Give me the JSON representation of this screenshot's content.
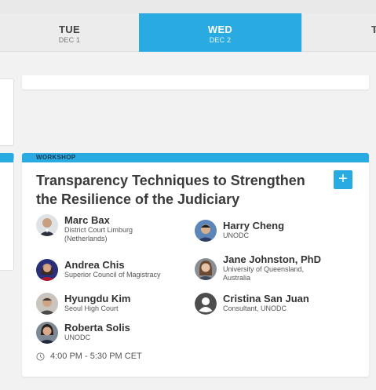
{
  "days": [
    {
      "name": "TUE",
      "date": "DEC 1"
    },
    {
      "name": "WED",
      "date": "DEC 2"
    },
    {
      "name": "T",
      "date": "D"
    }
  ],
  "session": {
    "type": "WORKSHOP",
    "title": "Transparency Techniques to Strengthen the Resilience of the Judiciary",
    "add_label": "+",
    "time": "4:00 PM - 5:30 PM CET",
    "speakers": [
      {
        "name": "Marc Bax",
        "affiliation": "District Court Limburg (Netherlands)",
        "avatar": "photo"
      },
      {
        "name": "Harry Cheng",
        "affiliation": "UNODC",
        "avatar": "photo"
      },
      {
        "name": "Andrea Chis",
        "affiliation": "Superior Council of Magistracy",
        "avatar": "photo"
      },
      {
        "name": "Jane Johnston, PhD",
        "affiliation": "University of Queensland, Australia",
        "avatar": "photo"
      },
      {
        "name": "Hyungdu Kim",
        "affiliation": "Seoul High Court",
        "avatar": "photo"
      },
      {
        "name": "Cristina San Juan",
        "affiliation": "Consultant, UNODC",
        "avatar": "placeholder-user-icon"
      },
      {
        "name": "Roberta Solis",
        "affiliation": "UNODC",
        "avatar": "photo"
      }
    ]
  },
  "colors": {
    "accent": "#29abe2",
    "header_text": "#1b3550"
  }
}
